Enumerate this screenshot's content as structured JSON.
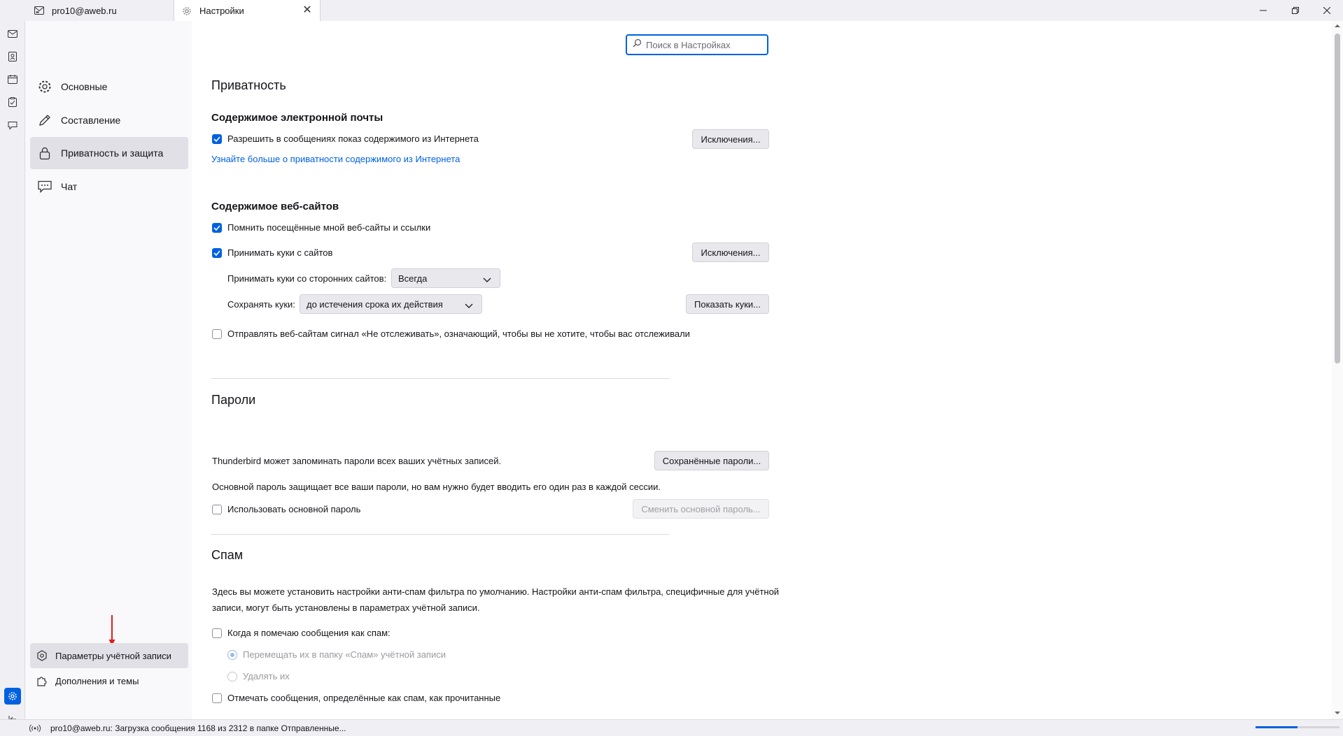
{
  "tabs": [
    {
      "label": "pro10@aweb.ru",
      "icon": "mail-icon"
    },
    {
      "label": "Настройки",
      "icon": "gear-icon",
      "active": true
    }
  ],
  "nav": {
    "items": [
      {
        "label": "Основные",
        "icon": "gear-icon"
      },
      {
        "label": "Составление",
        "icon": "pencil-icon"
      },
      {
        "label": "Приватность и защита",
        "icon": "lock-icon",
        "selected": true
      },
      {
        "label": "Чат",
        "icon": "chat-icon"
      }
    ],
    "bottom": [
      {
        "label": "Параметры учётной записи",
        "icon": "account-settings-icon"
      },
      {
        "label": "Дополнения и темы",
        "icon": "puzzle-icon"
      }
    ]
  },
  "search": {
    "placeholder": "Поиск в Настройках"
  },
  "privacy": {
    "heading": "Приватность",
    "email_heading": "Содержимое электронной почты",
    "allow_remote": {
      "label": "Разрешить в сообщениях показ содержимого из Интернета",
      "checked": true
    },
    "exceptions1": "Исключения...",
    "learn_more": "Узнайте больше о приватности содержимого из Интернета",
    "web_heading": "Содержимое веб-сайтов",
    "remember_sites": {
      "label": "Помнить посещённые мной веб-сайты и ссылки",
      "checked": true
    },
    "accept_cookies": {
      "label": "Принимать куки с сайтов",
      "checked": true
    },
    "exceptions2": "Исключения...",
    "third_party_label": "Принимать куки со сторонних сайтов:",
    "third_party_value": "Всегда",
    "keep_label": "Сохранять куки:",
    "keep_value": "до истечения срока их действия",
    "show_cookies": "Показать куки...",
    "dnt": {
      "label": "Отправлять веб-сайтам сигнал «Не отслеживать», означающий, чтобы вы не хотите, чтобы вас отслеживали",
      "checked": false
    }
  },
  "passwords": {
    "heading": "Пароли",
    "desc": "Thunderbird может запоминать пароли всех ваших учётных записей.",
    "saved_btn": "Сохранённые пароли...",
    "primary_desc": "Основной пароль защищает все ваши пароли, но вам нужно будет вводить его один раз в каждой сессии.",
    "use_primary": {
      "label": "Использовать основной пароль",
      "checked": false
    },
    "change_btn": "Сменить основной пароль..."
  },
  "spam": {
    "heading": "Спам",
    "desc_line1": "Здесь вы можете установить настройки анти-спам фильтра по умолчанию. Настройки анти-спам фильтра, специфичные для учётной",
    "desc_line2": "записи, могут быть установлены в параметрах учётной записи.",
    "when_mark": {
      "label": "Когда я помечаю сообщения как спам:",
      "checked": false
    },
    "move_option": "Перемещать их в папку «Спам» учётной записи",
    "delete_option": "Удалять их",
    "mark_read": {
      "label": "Отмечать сообщения, определённые как спам, как прочитанные",
      "checked": false
    }
  },
  "status": {
    "text": "pro10@aweb.ru: Загрузка сообщения 1168 из 2312 в папке Отправленные...",
    "progress": 0.5
  }
}
